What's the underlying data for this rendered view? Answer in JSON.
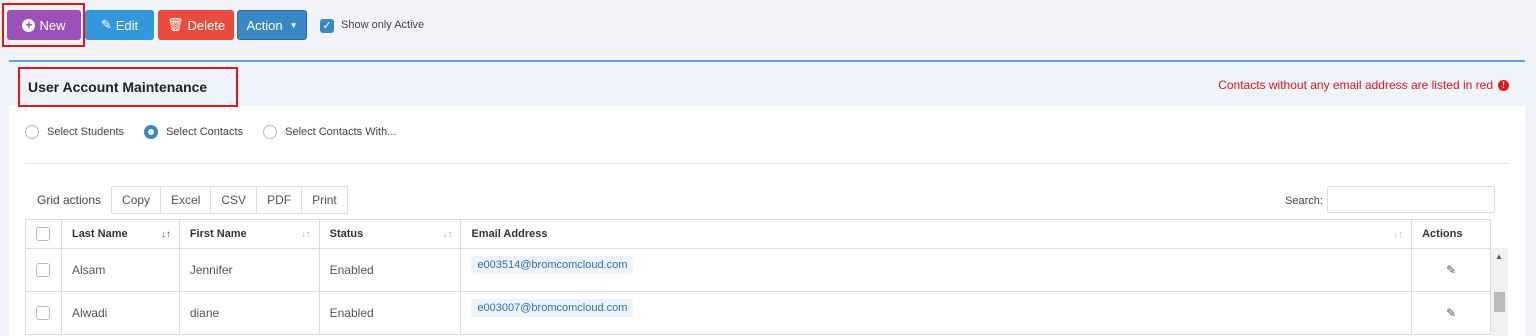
{
  "toolbar": {
    "new_label": "New",
    "edit_label": "Edit",
    "delete_label": "Delete",
    "action_label": "Action",
    "show_active_label": "Show only Active",
    "show_active_checked": true
  },
  "panel": {
    "title": "User Account Maintenance",
    "note": "Contacts without any email address are listed in red"
  },
  "radios": [
    {
      "label": "Select Students",
      "checked": false
    },
    {
      "label": "Select Contacts",
      "checked": true
    },
    {
      "label": "Select Contacts With...",
      "checked": false
    }
  ],
  "grid_actions": {
    "label": "Grid actions",
    "buttons": [
      "Copy",
      "Excel",
      "CSV",
      "PDF",
      "Print"
    ]
  },
  "search": {
    "label": "Search:",
    "value": ""
  },
  "table": {
    "headers": [
      "Last Name",
      "First Name",
      "Status",
      "Email Address",
      "Actions"
    ],
    "rows": [
      {
        "last": "Alsam",
        "first": "Jennifer",
        "status": "Enabled",
        "email": "e003514@bromcomcloud.com"
      },
      {
        "last": "Alwadi",
        "first": "diane",
        "status": "Enabled",
        "email": "e003007@bromcomcloud.com"
      }
    ]
  },
  "colors": {
    "new": "#9b51b8",
    "edit": "#3497db",
    "delete": "#e74c3c",
    "action": "#3a87c8",
    "highlight": "#e0171b"
  },
  "icons": [
    "plus-circle-icon",
    "edit-icon",
    "trash-icon",
    "caret-down-icon",
    "check-icon",
    "info-icon",
    "sort-icon"
  ]
}
